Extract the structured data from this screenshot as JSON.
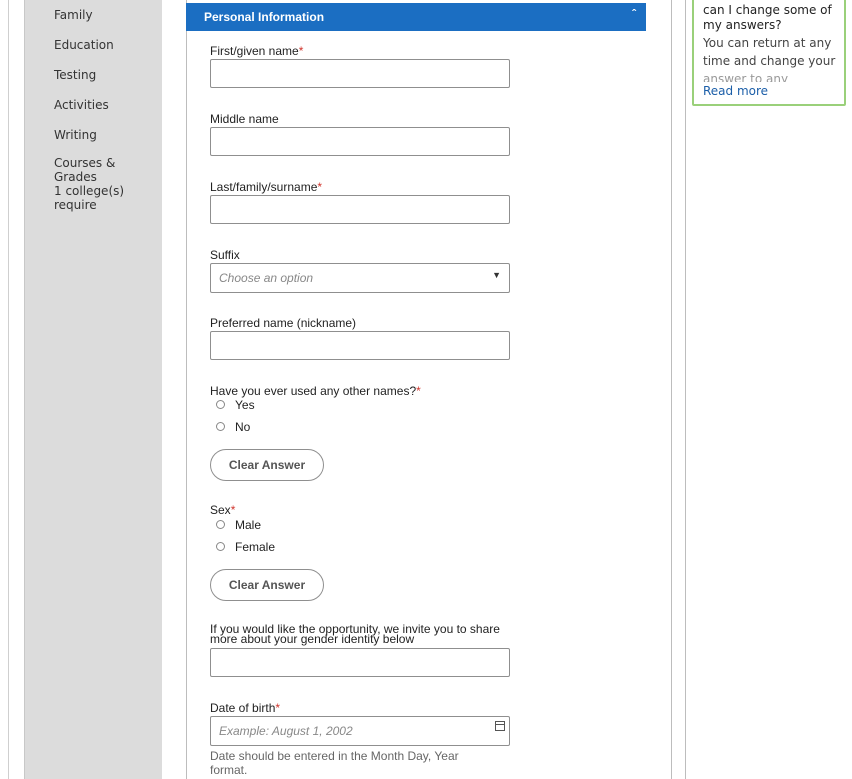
{
  "sidebar": {
    "items": [
      {
        "label": "Family"
      },
      {
        "label": "Education"
      },
      {
        "label": "Testing"
      },
      {
        "label": "Activities"
      },
      {
        "label": "Writing"
      },
      {
        "label": "Courses &"
      },
      {
        "label": "Grades"
      },
      {
        "label": "1 college(s)"
      },
      {
        "label": "require"
      }
    ]
  },
  "section": {
    "title": "Personal Information",
    "toggle_icon": "collapse-caret"
  },
  "form": {
    "first_name": {
      "label": "First/given name",
      "required_mark": "*",
      "value": ""
    },
    "middle_name": {
      "label": "Middle name",
      "value": ""
    },
    "last_name": {
      "label": "Last/family/surname",
      "required_mark": "*",
      "value": ""
    },
    "suffix": {
      "label": "Suffix",
      "placeholder": "Choose an option"
    },
    "preferred_name": {
      "label": "Preferred name (nickname)",
      "value": ""
    },
    "other_names": {
      "label": "Have you ever used any other names?",
      "required_mark": "*",
      "options": [
        "Yes",
        "No"
      ],
      "clear_label": "Clear Answer"
    },
    "sex": {
      "label": "Sex",
      "required_mark": "*",
      "options": [
        "Male",
        "Female"
      ],
      "clear_label": "Clear Answer"
    },
    "gender_identity": {
      "label_line1": "If you would like the opportunity, we invite you to share",
      "label_line2": "more about your gender identity below",
      "value": ""
    },
    "dob": {
      "label": "Date of birth",
      "required_mark": "*",
      "placeholder": "Example: August 1, 2002",
      "help_line1": "Date should be entered in the Month Day, Year",
      "help_line2": "format."
    }
  },
  "faq": {
    "question_line1": "can I change some of",
    "question_line2": "my answers?",
    "answer_line1": "You can return at any",
    "answer_line2": "time and change your",
    "answer_line3": "answer to any question",
    "read_more": "Read more"
  }
}
